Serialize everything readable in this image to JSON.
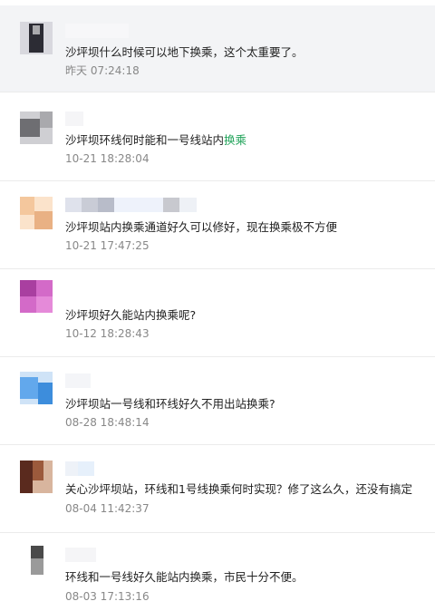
{
  "comments": [
    {
      "text": "沙坪坝什么时候可以地下换乘，这个太重要了。",
      "time": "昨天 07:24:18",
      "avatar_icon": "blurred-avatar",
      "avatar_colors": [
        "#2c2c34",
        "#d8d8de",
        "#ffffff"
      ]
    },
    {
      "text_before": "沙坪坝环线何时能和一号线站内",
      "text_link": "换乘",
      "time": "10-21 18:28:04",
      "avatar_icon": "blurred-avatar",
      "avatar_colors": [
        "#6e6e72",
        "#a9a9ad",
        "#cfcfd3"
      ]
    },
    {
      "text": "沙坪坝站内换乘通道好久可以修好，现在换乘极不方便",
      "time": "10-21 17:47:25",
      "avatar_icon": "blurred-avatar",
      "avatar_colors": [
        "#f4c79d",
        "#fbe3cb",
        "#e9b184"
      ]
    },
    {
      "text": "沙坪坝好久能站内换乘呢?",
      "time": "10-12 18:28:43",
      "avatar_icon": "blurred-avatar",
      "avatar_colors": [
        "#a93fa0",
        "#d36ac8",
        "#e58ad9"
      ]
    },
    {
      "text": "沙坪坝站一号线和环线好久不用出站换乘?",
      "time": "08-28 18:48:14",
      "avatar_icon": "blurred-avatar",
      "avatar_colors": [
        "#3d8ddc",
        "#62a8ec",
        "#cfe3f7"
      ]
    },
    {
      "text": "关心沙坪坝站，环线和1号线换乘何时实现？修了这么久，还没有搞定",
      "time": "08-04 11:42:37",
      "avatar_icon": "blurred-avatar",
      "avatar_colors": [
        "#5a2a1e",
        "#9c5a3c",
        "#d8b59e"
      ]
    },
    {
      "text": "环线和一号线好久能站内换乘，市民十分不便。",
      "time": "08-03 17:13:16",
      "avatar_icon": "blurred-avatar",
      "avatar_colors": [
        "#4a4a4a",
        "#9a9a9a",
        "#e4e4e4"
      ]
    }
  ]
}
